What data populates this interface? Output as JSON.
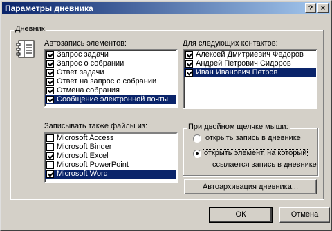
{
  "window": {
    "title": "Параметры дневника",
    "help_btn": "?",
    "close_btn": "×"
  },
  "journal_group": {
    "label": "Дневник",
    "auto_label": "Автозапись элементов:",
    "items": [
      {
        "label": "Запрос задачи",
        "checked": true
      },
      {
        "label": "Запрос о собрании",
        "checked": true
      },
      {
        "label": "Ответ задачи",
        "checked": true
      },
      {
        "label": "Ответ на запрос о собрании",
        "checked": true
      },
      {
        "label": "Отмена собрания",
        "checked": true
      },
      {
        "label": "Сообщение электронной почты",
        "checked": true,
        "selected": true
      }
    ],
    "contacts_label": "Для следующих контактов:",
    "contacts": [
      {
        "label": "Алексей Дмитриевич Федоров",
        "checked": true
      },
      {
        "label": "Андрей Петрович Сидоров",
        "checked": true
      },
      {
        "label": "Иван Иванович Петров",
        "checked": true,
        "selected": true
      }
    ],
    "files_label": "Записывать также файлы из:",
    "files": [
      {
        "label": "Microsoft Access",
        "checked": false
      },
      {
        "label": "Microsoft Binder",
        "checked": false
      },
      {
        "label": "Microsoft Excel",
        "checked": true
      },
      {
        "label": "Microsoft PowerPoint",
        "checked": false
      },
      {
        "label": "Microsoft Word",
        "checked": true,
        "selected": true
      }
    ],
    "dblclick_label": "При двойном щелчке мыши:",
    "radio1": "открыть запись в дневнике",
    "radio2_line1": "открыть элемент, на который",
    "radio2_line2": "ссылается запись в дневнике",
    "archive_button": "Автоархивация дневника..."
  },
  "buttons": {
    "ok": "ОК",
    "cancel": "Отмена"
  }
}
